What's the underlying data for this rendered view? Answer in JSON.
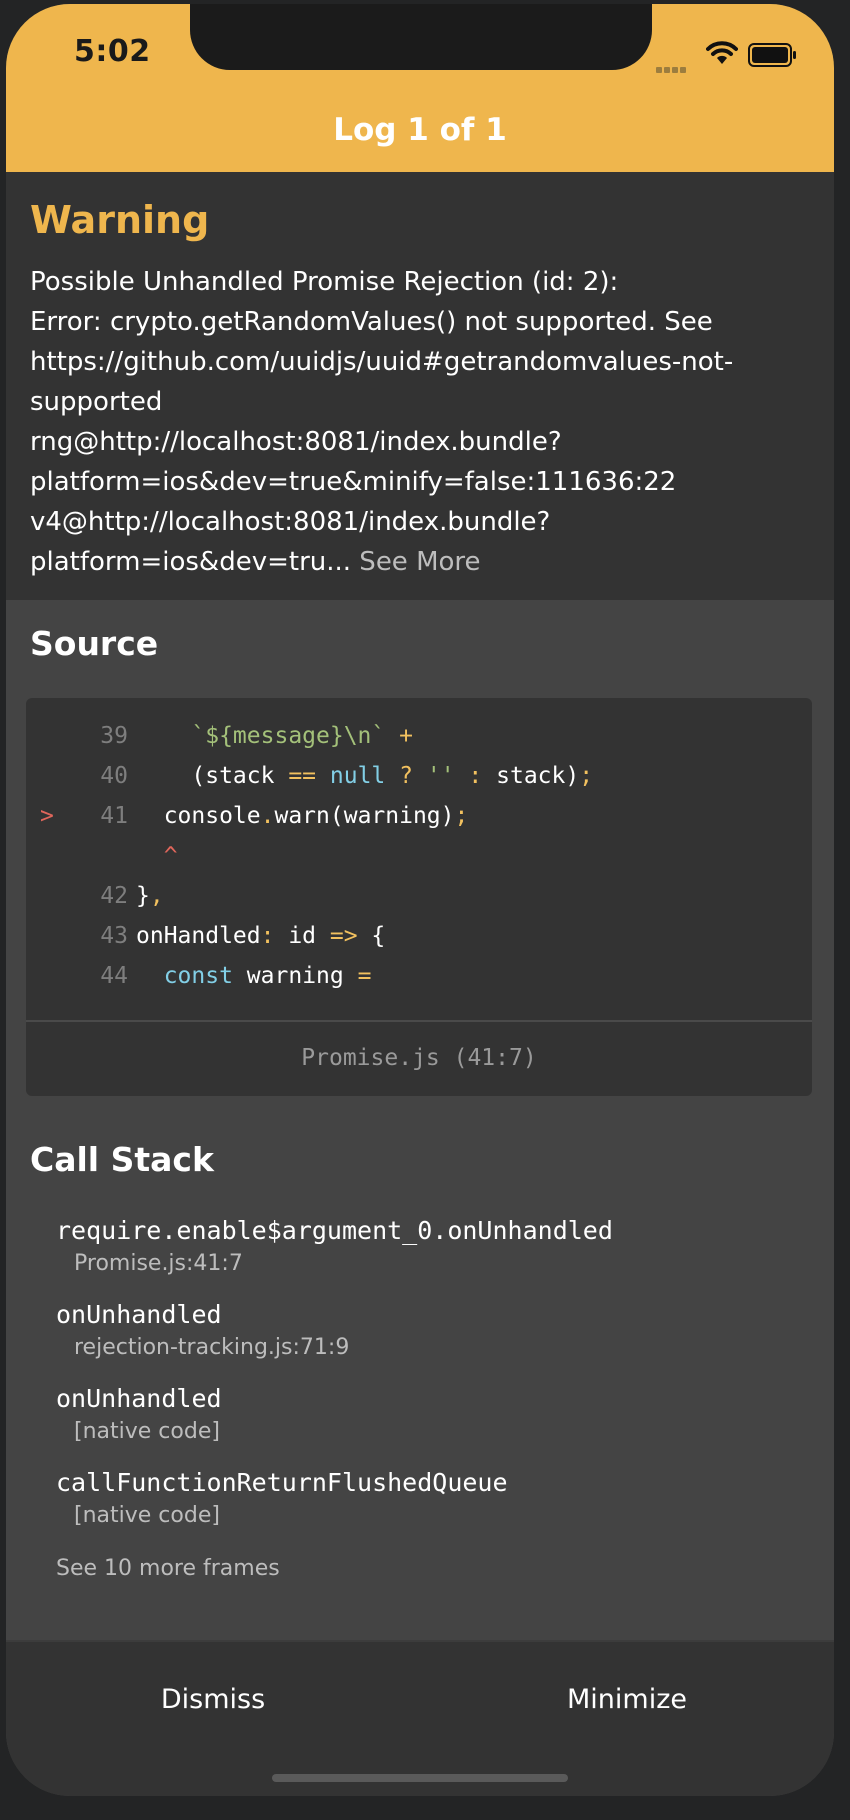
{
  "status_bar": {
    "time": "5:02"
  },
  "header": {
    "title": "Log 1 of 1"
  },
  "warning": {
    "level": "Warning",
    "message": "Possible Unhandled Promise Rejection (id: 2):\nError: crypto.getRandomValues() not supported. See\nhttps://github.com/uuidjs/uuid#getrandomvalues-not-\nsupported\nrng@http://localhost:8081/index.bundle?\nplatform=ios&dev=true&minify=false:111636:22\nv4@http://localhost:8081/index.bundle?\nplatform=ios&dev=tru...",
    "see_more": " See More"
  },
  "source": {
    "title": "Source",
    "lines": [
      {
        "marker": "",
        "no": "39",
        "code": "    `${message}\\n` +"
      },
      {
        "marker": "",
        "no": "40",
        "code": "    (stack == null ? '' : stack);"
      },
      {
        "marker": ">",
        "no": "41",
        "code": "  console.warn(warning);"
      },
      {
        "marker": "",
        "no": "",
        "code": "  ^"
      },
      {
        "marker": "",
        "no": "42",
        "code": "},"
      },
      {
        "marker": "",
        "no": "43",
        "code": "onHandled: id => {"
      },
      {
        "marker": "",
        "no": "44",
        "code": "  const warning ="
      }
    ],
    "location": "Promise.js (41:7)"
  },
  "call_stack": {
    "title": "Call Stack",
    "frames": [
      {
        "fn": "require.enable$argument_0.onUnhandled",
        "loc": "Promise.js:41:7"
      },
      {
        "fn": "onUnhandled",
        "loc": "rejection-tracking.js:71:9"
      },
      {
        "fn": "onUnhandled",
        "loc": "[native code]"
      },
      {
        "fn": "callFunctionReturnFlushedQueue",
        "loc": "[native code]"
      }
    ],
    "see_more": "See 10 more frames"
  },
  "footer": {
    "dismiss": "Dismiss",
    "minimize": "Minimize"
  },
  "colors": {
    "accent": "#efb64d",
    "panel": "#333333",
    "background": "#444444"
  },
  "icons": {
    "signal": "cellular-signal-icon",
    "wifi": "wifi-icon",
    "battery": "battery-icon"
  }
}
